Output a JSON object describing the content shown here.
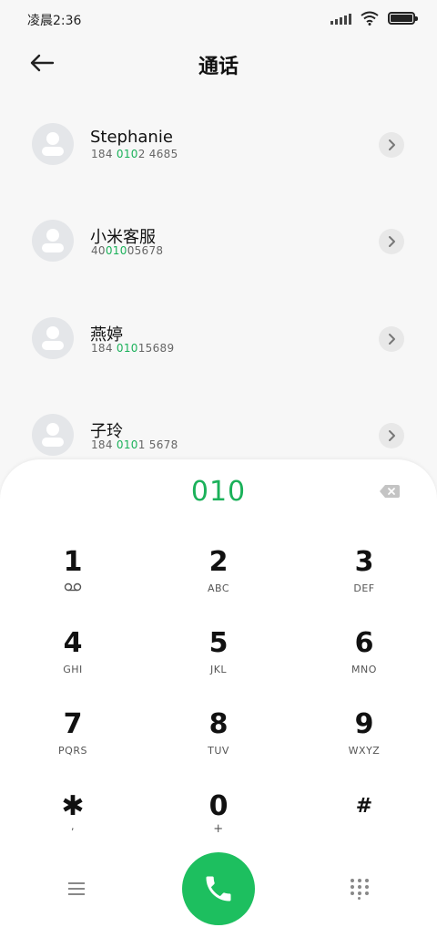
{
  "status_bar": {
    "time": "凌晨2:36",
    "icons": [
      "signal-icon",
      "wifi-icon",
      "battery-icon"
    ]
  },
  "header": {
    "title": "通话",
    "back_icon": "arrow-left-icon"
  },
  "contacts": [
    {
      "name": "Stephanie",
      "number_pre": "184 ",
      "number_match": "010",
      "number_post": "2 4685"
    },
    {
      "name": "小米客服",
      "number_pre": "40",
      "number_match": "010",
      "number_post": "05678"
    },
    {
      "name": "燕婷",
      "number_pre": "184 ",
      "number_match": "010",
      "number_post": "15689"
    },
    {
      "name": "子玲",
      "number_pre": "184 ",
      "number_match": "010",
      "number_post": "1 5678"
    }
  ],
  "dialpad": {
    "input": "010",
    "keys": [
      {
        "digit": "1",
        "letters": ""
      },
      {
        "digit": "2",
        "letters": "ABC"
      },
      {
        "digit": "3",
        "letters": "DEF"
      },
      {
        "digit": "4",
        "letters": "GHI"
      },
      {
        "digit": "5",
        "letters": "JKL"
      },
      {
        "digit": "6",
        "letters": "MNO"
      },
      {
        "digit": "7",
        "letters": "PQRS"
      },
      {
        "digit": "8",
        "letters": "TUV"
      },
      {
        "digit": "9",
        "letters": "WXYZ"
      },
      {
        "digit": "✱",
        "letters": ","
      },
      {
        "digit": "0",
        "letters": "+"
      },
      {
        "digit": "#",
        "letters": ""
      }
    ]
  },
  "colors": {
    "accent": "#1bb15a",
    "call_button": "#1dbf5f",
    "avatar_bg": "#e4e6e9"
  }
}
